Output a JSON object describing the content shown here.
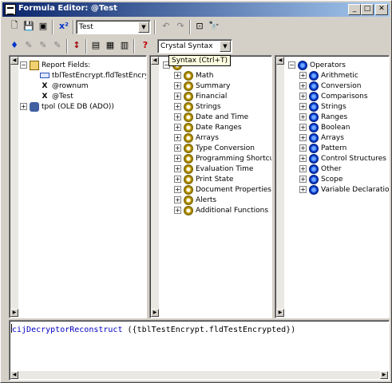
{
  "window": {
    "title": "Formula Editor: @Test"
  },
  "toolbar1": {
    "formula_name": "Test"
  },
  "toolbar2": {
    "syntax": "Crystal Syntax"
  },
  "tooltip": "Syntax (Ctrl+T)",
  "left_panel": {
    "root": "Report Fields:",
    "items": [
      "tblTestEncrypt.fldTestEncrypted",
      "@rownum",
      "@Test"
    ],
    "db": "tpol (OLE DB (ADO))"
  },
  "middle_panel": {
    "items": [
      "Math",
      "Summary",
      "Financial",
      "Strings",
      "Date and Time",
      "Date Ranges",
      "Arrays",
      "Type Conversion",
      "Programming Shortcuts",
      "Evaluation Time",
      "Print State",
      "Document Properties",
      "Alerts",
      "Additional Functions"
    ]
  },
  "right_panel": {
    "root": "Operators",
    "items": [
      "Arithmetic",
      "Conversion",
      "Comparisons",
      "Strings",
      "Ranges",
      "Boolean",
      "Arrays",
      "Pattern",
      "Control Structures",
      "Other",
      "Scope",
      "Variable Declarations"
    ]
  },
  "editor": {
    "func": "cijDecryptorReconstruct",
    "args": " ({tblTestEncrypt.fldTestEncrypted})"
  }
}
